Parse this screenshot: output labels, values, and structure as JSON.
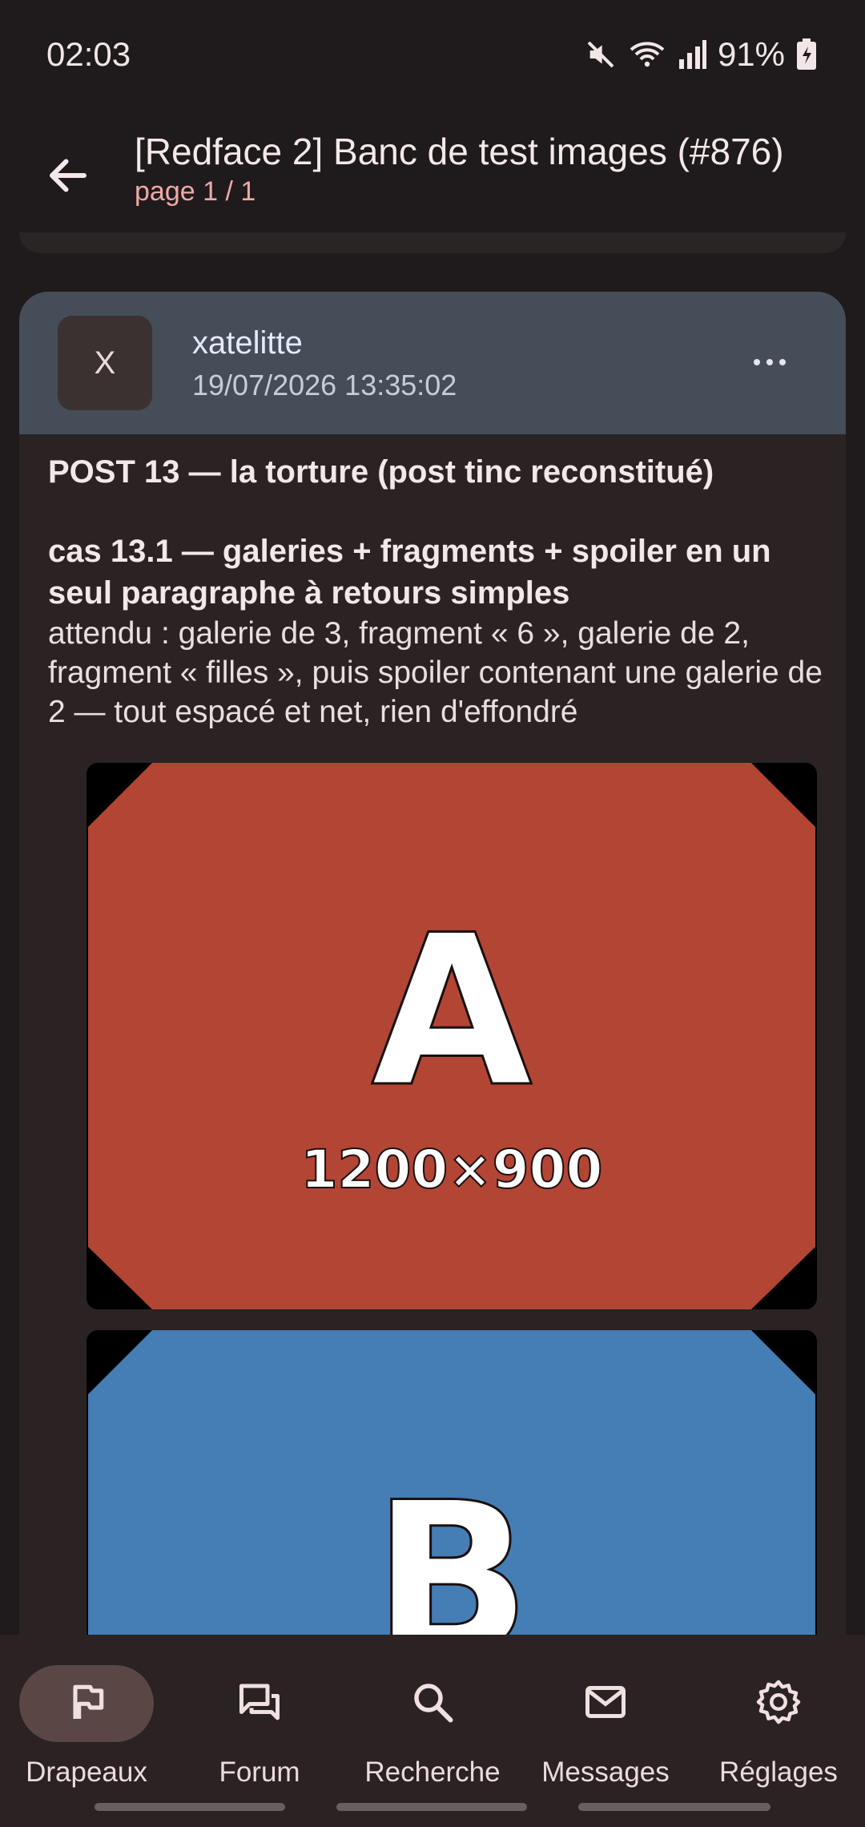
{
  "status": {
    "time": "02:03",
    "battery": "91%"
  },
  "app_bar": {
    "title": "[Redface 2] Banc de test images (#876)",
    "subtitle": "page 1 / 1"
  },
  "post": {
    "avatar_letter": "X",
    "author": "xatelitte",
    "date": "19/07/2026 13:35:02",
    "title": "POST 13 — la torture (post tinc reconstitué)",
    "case_title": "cas 13.1 — galeries + fragments + spoiler en un seul paragraphe à retours simples",
    "expected": "attendu : galerie de 3, fragment « 6 », galerie de 2, fragment « filles », puis spoiler contenant une galerie de 2 — tout espacé et net, rien d'effondré",
    "images": [
      {
        "letter": "A",
        "dimensions": "1200×900",
        "color": "#b34535"
      },
      {
        "letter": "B",
        "color": "#457db5"
      }
    ]
  },
  "nav": {
    "items": [
      {
        "label": "Drapeaux",
        "icon": "flag-icon",
        "active": true
      },
      {
        "label": "Forum",
        "icon": "forum-icon",
        "active": false
      },
      {
        "label": "Recherche",
        "icon": "search-icon",
        "active": false
      },
      {
        "label": "Messages",
        "icon": "mail-icon",
        "active": false
      },
      {
        "label": "Réglages",
        "icon": "gear-icon",
        "active": false
      }
    ]
  }
}
